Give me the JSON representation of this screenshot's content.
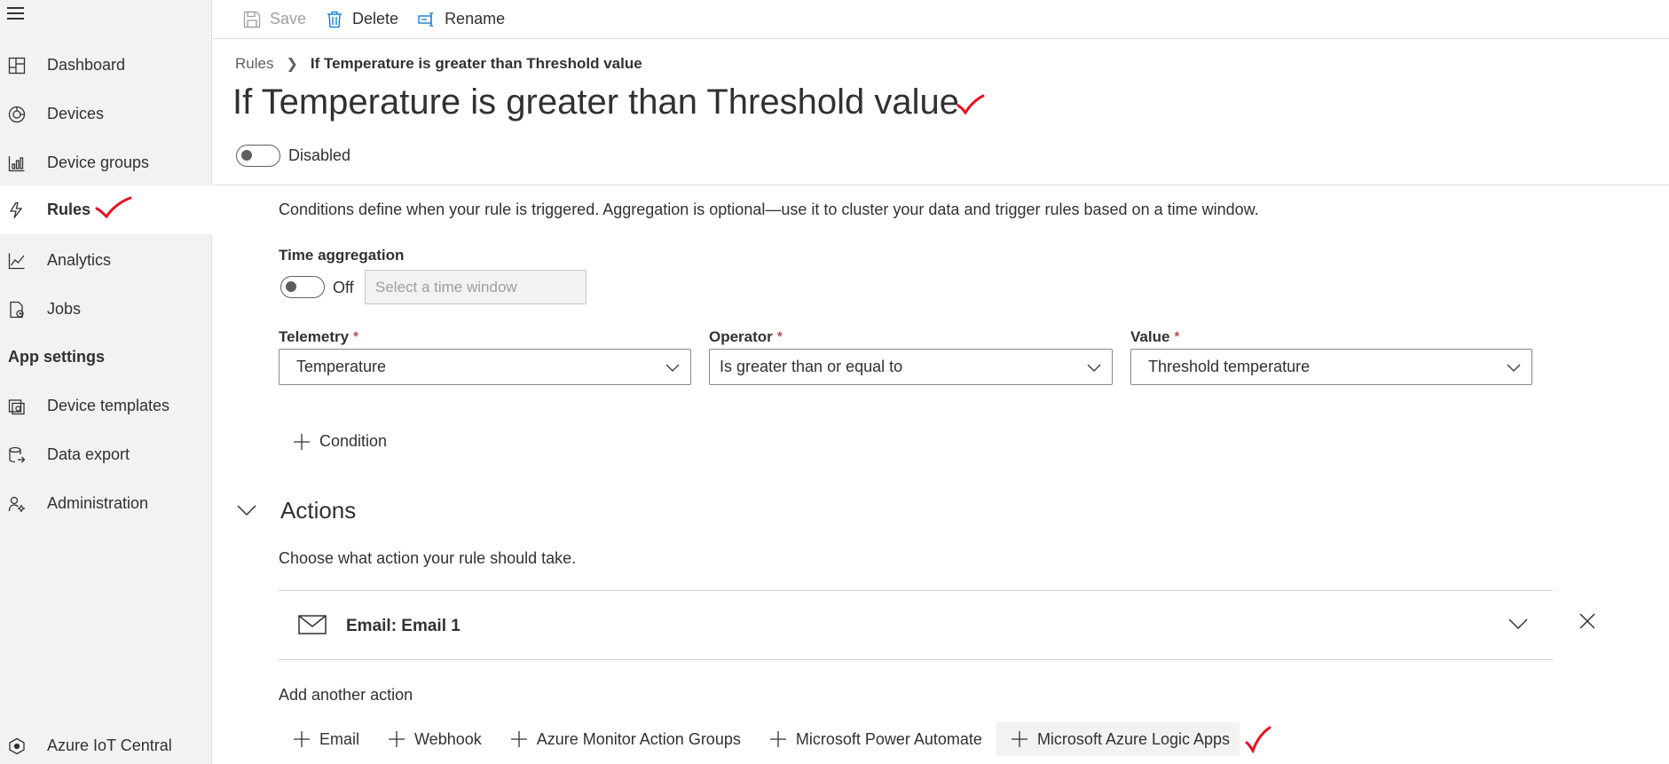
{
  "sidebar": {
    "items": [
      {
        "label": "Dashboard",
        "icon": "dashboard-icon"
      },
      {
        "label": "Devices",
        "icon": "devices-icon"
      },
      {
        "label": "Device groups",
        "icon": "device-groups-icon"
      },
      {
        "label": "Rules",
        "icon": "rules-icon",
        "active": true
      },
      {
        "label": "Analytics",
        "icon": "analytics-icon"
      },
      {
        "label": "Jobs",
        "icon": "jobs-icon"
      }
    ],
    "section_title": "App settings",
    "settings_items": [
      {
        "label": "Device templates",
        "icon": "device-templates-icon"
      },
      {
        "label": "Data export",
        "icon": "data-export-icon"
      },
      {
        "label": "Administration",
        "icon": "administration-icon"
      }
    ],
    "footer_label": "Azure IoT Central"
  },
  "toolbar": {
    "save_label": "Save",
    "delete_label": "Delete",
    "rename_label": "Rename"
  },
  "breadcrumb": {
    "parent": "Rules",
    "current": "If Temperature is greater than Threshold value"
  },
  "page": {
    "title": "If Temperature is greater than Threshold value",
    "status_label": "Disabled",
    "enabled": false
  },
  "conditions": {
    "description": "Conditions define when your rule is triggered. Aggregation is optional—use it to cluster your data and trigger rules based on a time window.",
    "time_aggregation_label": "Time aggregation",
    "time_aggregation_state": "Off",
    "time_window_placeholder": "Select a time window",
    "telemetry_label": "Telemetry",
    "telemetry_value": "Temperature",
    "operator_label": "Operator",
    "operator_value": "Is greater than or equal to",
    "value_label": "Value",
    "value_value": "Threshold temperature",
    "required_marker": "*",
    "add_condition_label": "Condition"
  },
  "actions": {
    "title": "Actions",
    "description": "Choose what action your rule should take.",
    "items": [
      {
        "label": "Email: Email 1",
        "icon": "mail-icon"
      }
    ],
    "add_another_label": "Add another action",
    "add_buttons": [
      {
        "label": "Email"
      },
      {
        "label": "Webhook"
      },
      {
        "label": "Azure Monitor Action Groups"
      },
      {
        "label": "Microsoft Power Automate"
      },
      {
        "label": "Microsoft Azure Logic Apps",
        "highlighted": true
      }
    ]
  },
  "colors": {
    "sidebar_bg": "#f3f2f1",
    "text": "#323130",
    "annotation_red": "#e81123",
    "required_red": "#a4262c"
  }
}
